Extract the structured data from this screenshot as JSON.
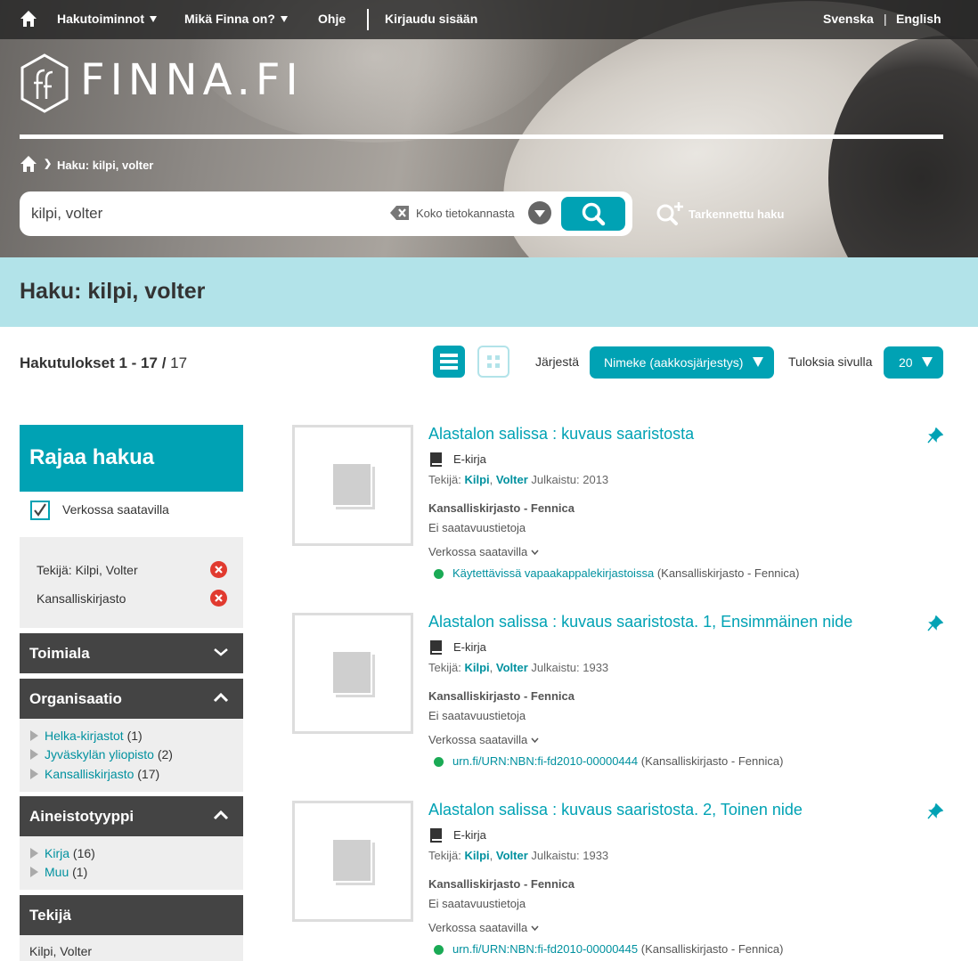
{
  "topnav": {
    "search_functions": "Hakutoiminnot",
    "what_is_finna": "Mikä Finna on?",
    "help": "Ohje",
    "login": "Kirjaudu sisään",
    "lang_sv": "Svenska",
    "lang_sep": "|",
    "lang_en": "English"
  },
  "logo": {
    "text": "FINNA.FI"
  },
  "breadcrumb": {
    "sep": "❯",
    "current": "Haku: kilpi, volter"
  },
  "search": {
    "query": "kilpi, volter",
    "scope": "Koko tietokannasta",
    "advanced": "Tarkennettu haku"
  },
  "page": {
    "title": "Haku: kilpi, volter"
  },
  "results": {
    "label": "Hakutulokset",
    "range": "1 - 17",
    "sep": "/",
    "total": "17",
    "sort_label": "Järjestä",
    "sort_value": "Nimeke (aakkosjärjestys)",
    "per_page_label": "Tuloksia sivulla",
    "per_page_value": "20"
  },
  "sidebar": {
    "title": "Rajaa hakua",
    "online_label": "Verkossa saatavilla",
    "active_filters": [
      "Tekijä: Kilpi, Volter",
      "Kansalliskirjasto"
    ],
    "facets": {
      "toimiala": {
        "title": "Toimiala"
      },
      "organisaatio": {
        "title": "Organisaatio",
        "items": [
          {
            "label": "Helka-kirjastot",
            "count": "(1)"
          },
          {
            "label": "Jyväskylän yliopisto",
            "count": "(2)"
          },
          {
            "label": "Kansalliskirjasto",
            "count": "(17)"
          }
        ]
      },
      "aineistotyyppi": {
        "title": "Aineistotyyppi",
        "items": [
          {
            "label": "Kirja",
            "count": "(16)"
          },
          {
            "label": "Muu",
            "count": "(1)"
          }
        ]
      },
      "tekija": {
        "title": "Tekijä",
        "items": [
          "Kilpi, Volter"
        ]
      }
    }
  },
  "records": [
    {
      "title": "Alastalon salissa : kuvaus saaristosta",
      "format": "E-kirja",
      "author_label": "Tekijä:",
      "author_last": "Kilpi",
      "author_first": "Volter",
      "published_label": "Julkaistu:",
      "year": "2013",
      "org": "Kansalliskirjasto - Fennica",
      "availability": "Ei saatavuustietoja",
      "online_label": "Verkossa saatavilla",
      "link_text": "Käytettävissä vapaakappalekirjastoissa",
      "link_org": "(Kansalliskirjasto - Fennica)"
    },
    {
      "title": "Alastalon salissa : kuvaus saaristosta. 1, Ensimmäinen nide",
      "format": "E-kirja",
      "author_label": "Tekijä:",
      "author_last": "Kilpi",
      "author_first": "Volter",
      "published_label": "Julkaistu:",
      "year": "1933",
      "org": "Kansalliskirjasto - Fennica",
      "availability": "Ei saatavuustietoja",
      "online_label": "Verkossa saatavilla",
      "link_text": "urn.fi/URN:NBN:fi-fd2010-00000444",
      "link_org": "(Kansalliskirjasto - Fennica)"
    },
    {
      "title": "Alastalon salissa : kuvaus saaristosta. 2, Toinen nide",
      "format": "E-kirja",
      "author_label": "Tekijä:",
      "author_last": "Kilpi",
      "author_first": "Volter",
      "published_label": "Julkaistu:",
      "year": "1933",
      "org": "Kansalliskirjasto - Fennica",
      "availability": "Ei saatavuustietoja",
      "online_label": "Verkossa saatavilla",
      "link_text": "urn.fi/URN:NBN:fi-fd2010-00000445",
      "link_org": "(Kansalliskirjasto - Fennica)"
    }
  ],
  "colors": {
    "accent": "#00a2b4",
    "band": "#b2e3e9",
    "facet_header": "#444444",
    "remove": "#e13a2f",
    "available": "#1aaa55"
  },
  "icons": {
    "home": "home-icon",
    "search": "search-icon",
    "clear": "backspace-icon",
    "advanced": "magnifier-plus-icon",
    "list_view": "list-view-icon",
    "grid_view": "grid-view-icon",
    "pin": "pin-icon",
    "book": "book-icon",
    "remove": "close-icon"
  }
}
